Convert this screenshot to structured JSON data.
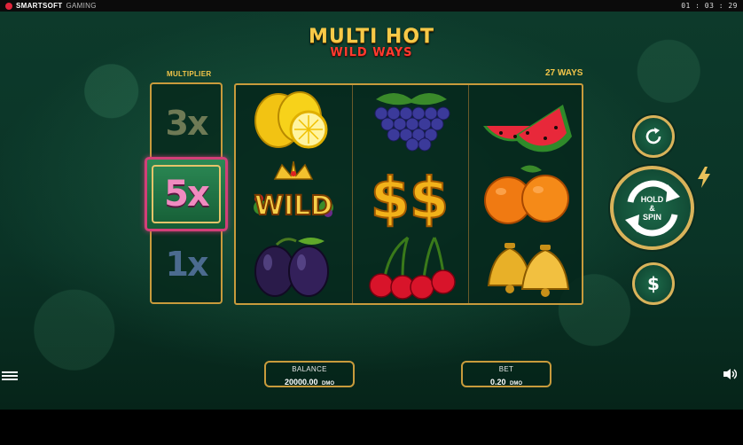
{
  "topbar": {
    "brand_bold": "SMARTSOFT",
    "brand_rest": "GAMING",
    "clock": "01 : 03 : 29"
  },
  "title": {
    "line1": "MULTI HOT",
    "line2": "WILD WAYS"
  },
  "multiplier": {
    "label": "MULTIPLIER",
    "values": [
      "3x",
      "5x",
      "1x"
    ],
    "active": "5x"
  },
  "ways": {
    "label": "27 WAYS"
  },
  "reels": [
    [
      "lemon",
      "wild",
      "plum"
    ],
    [
      "grapes",
      "dollar",
      "cherry"
    ],
    [
      "watermelon",
      "orange",
      "bell"
    ]
  ],
  "wild_text": "WILD",
  "spin_button": {
    "line1": "HOLD",
    "line2": "&",
    "line3": "SPIN"
  },
  "balance": {
    "label": "BALANCE",
    "value": "20000.00",
    "currency": "DMO"
  },
  "bet": {
    "label": "BET",
    "value": "0.20",
    "currency": "DMO"
  },
  "icons": {
    "autoplay": "refresh-icon",
    "buy": "dollar-icon",
    "turbo": "lightning-icon",
    "menu": "hamburger-menu-icon",
    "sound": "speaker-icon"
  },
  "colors": {
    "gold": "#c89b3c",
    "title_gold": "#f7c948",
    "title_red": "#ff3b2f",
    "active_frame": "#d23f78"
  }
}
